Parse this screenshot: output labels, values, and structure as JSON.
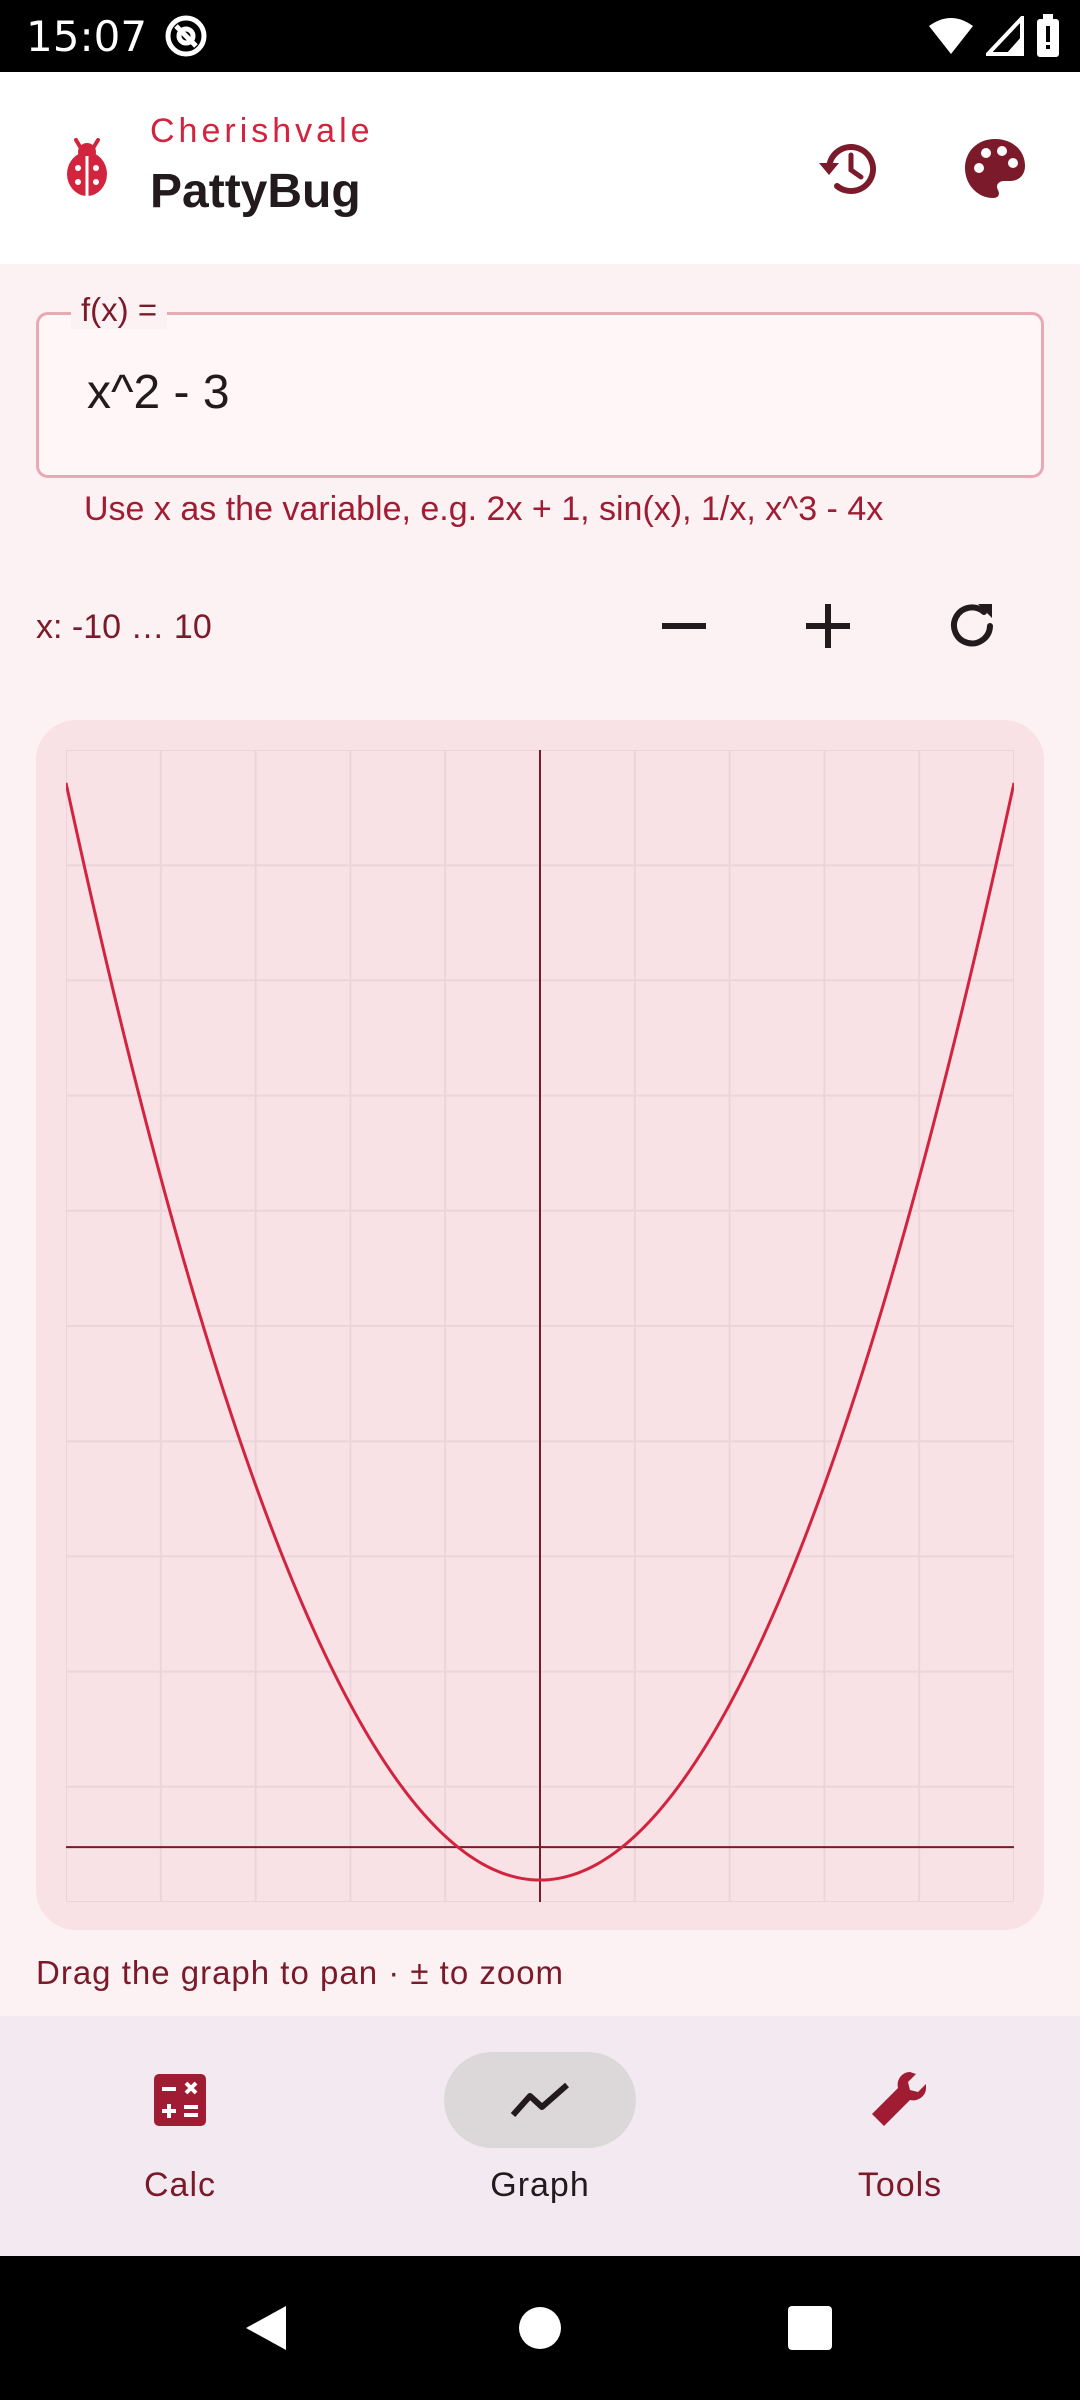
{
  "status_bar": {
    "time": "15:07",
    "icons": [
      "at-sign-icon",
      "wifi-icon",
      "cell-signal-icon",
      "battery-icon"
    ]
  },
  "app_bar": {
    "brand": "Cherishvale",
    "title": "PattyBug",
    "logo_icon": "ladybug-icon",
    "actions": [
      "history-icon",
      "palette-icon"
    ],
    "accent_color": "#d2243f"
  },
  "function_input": {
    "label": "f(x) =",
    "value": "x^2 - 3",
    "helper": "Use x as the variable, e.g. 2x + 1, sin(x), 1/x, x^3 - 4x"
  },
  "range": {
    "label": "x: -10 … 10",
    "controls": [
      "zoom-out-icon",
      "zoom-in-icon",
      "reset-icon"
    ]
  },
  "chart_data": {
    "type": "line",
    "function": "x^2 - 3",
    "xlim": [
      -10,
      10
    ],
    "ylim": [
      -5,
      100
    ],
    "grid": true,
    "x": [
      -10,
      -8,
      -6,
      -4,
      -2,
      0,
      2,
      4,
      6,
      8,
      10
    ],
    "series": [
      {
        "values": [
          97,
          61,
          33,
          13,
          1,
          -3,
          1,
          13,
          33,
          61,
          97
        ],
        "color": "#d2243f"
      }
    ]
  },
  "graph_hint": "Drag the graph to pan · ± to zoom",
  "bottom_nav": {
    "items": [
      {
        "label": "Calc",
        "icon": "calculator-icon"
      },
      {
        "label": "Graph",
        "icon": "trend-icon"
      },
      {
        "label": "Tools",
        "icon": "wrench-icon"
      }
    ],
    "active": "Graph"
  },
  "system_nav": [
    "back-icon",
    "home-icon",
    "recents-icon"
  ]
}
